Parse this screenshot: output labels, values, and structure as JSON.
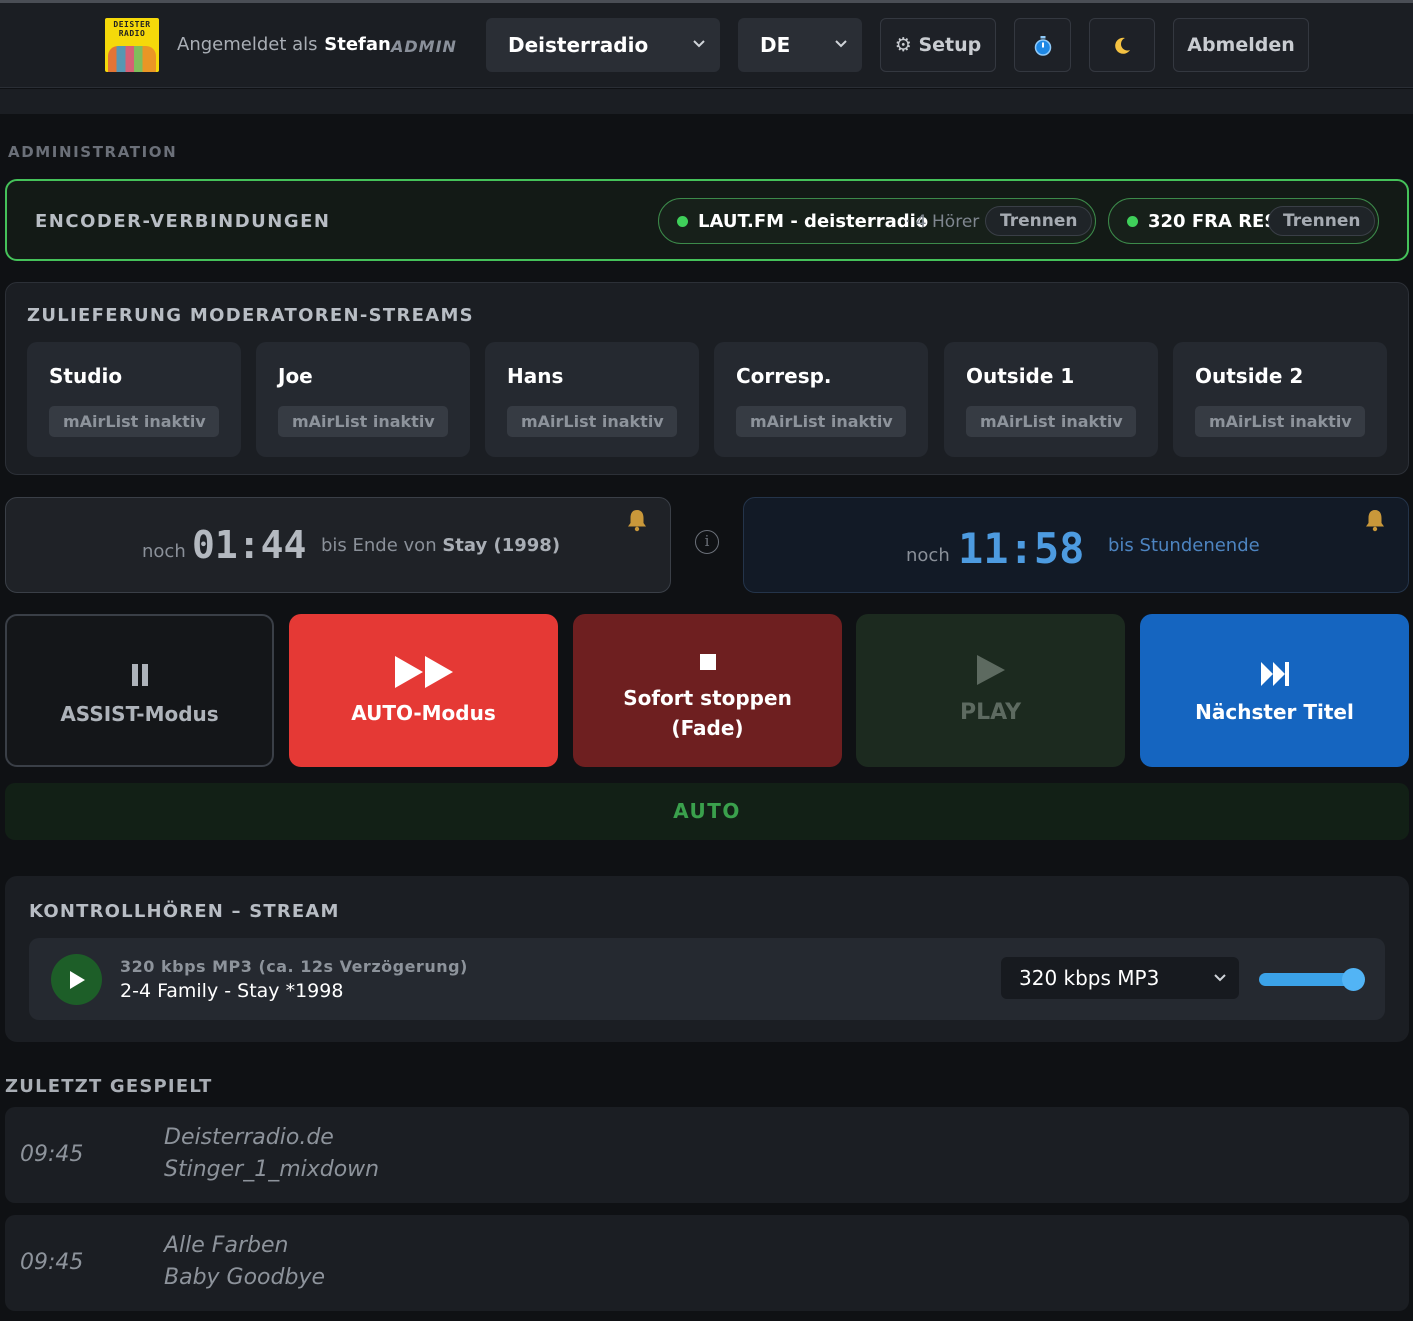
{
  "header": {
    "logo_text": "DEISTER RADIO",
    "logged_in_prefix": "Angemeldet als",
    "user": "Stefan",
    "role": "ADMIN",
    "station_select": "Deisterradio",
    "language_select": "DE",
    "setup_label": "Setup",
    "logout_label": "Abmelden"
  },
  "admin": {
    "section_label": "ADMINISTRATION"
  },
  "encoder": {
    "title": "ENCODER-VERBINDUNGEN",
    "connections": [
      {
        "name": "LAUT.FM - deisterradio",
        "listeners": "· 4 Hörer",
        "disconnect_label": "Trennen",
        "status_color": "#3fcf5a"
      },
      {
        "name": "320 FRA RES",
        "listeners": "",
        "disconnect_label": "Trennen",
        "status_color": "#3fcf5a"
      }
    ]
  },
  "streams": {
    "title": "ZULIEFERUNG MODERATOREN-STREAMS",
    "items": [
      {
        "name": "Studio",
        "status": "mAirList inaktiv"
      },
      {
        "name": "Joe",
        "status": "mAirList inaktiv"
      },
      {
        "name": "Hans",
        "status": "mAirList inaktiv"
      },
      {
        "name": "Corresp.",
        "status": "mAirList inaktiv"
      },
      {
        "name": "Outside 1",
        "status": "mAirList inaktiv"
      },
      {
        "name": "Outside 2",
        "status": "mAirList inaktiv"
      }
    ]
  },
  "timers": {
    "track": {
      "prefix": "noch",
      "time": "01:44",
      "suffix": "bis Ende von",
      "title": "Stay (1998)"
    },
    "hour": {
      "prefix": "noch",
      "time": "11:58",
      "suffix": "bis Stundenende"
    }
  },
  "controls": {
    "assist_label": "ASSIST-Modus",
    "auto_label": "AUTO-Modus",
    "stop_label_1": "Sofort stoppen",
    "stop_label_2": "(Fade)",
    "play_label": "PLAY",
    "next_label": "Nächster Titel",
    "mode_status": "AUTO"
  },
  "monitor": {
    "title": "KONTROLLHÖREN – STREAM",
    "meta": "320 kbps MP3 (ca. 12s Verzögerung)",
    "now_playing": "2-4 Family - Stay *1998",
    "quality_select": "320 kbps MP3",
    "volume": 1.0
  },
  "recent": {
    "title": "ZULETZT GESPIELT",
    "items": [
      {
        "time": "09:45",
        "artist": "Deisterradio.de",
        "title": "Stinger_1_mixdown"
      },
      {
        "time": "09:45",
        "artist": "Alle Farben",
        "title": "Baby Goodbye"
      }
    ]
  },
  "colors": {
    "accent_green": "#45c25a",
    "auto_red": "#e53935",
    "stop_darkred": "#6e1f20",
    "next_blue": "#1565c0",
    "timer_blue": "#4d9be0"
  }
}
